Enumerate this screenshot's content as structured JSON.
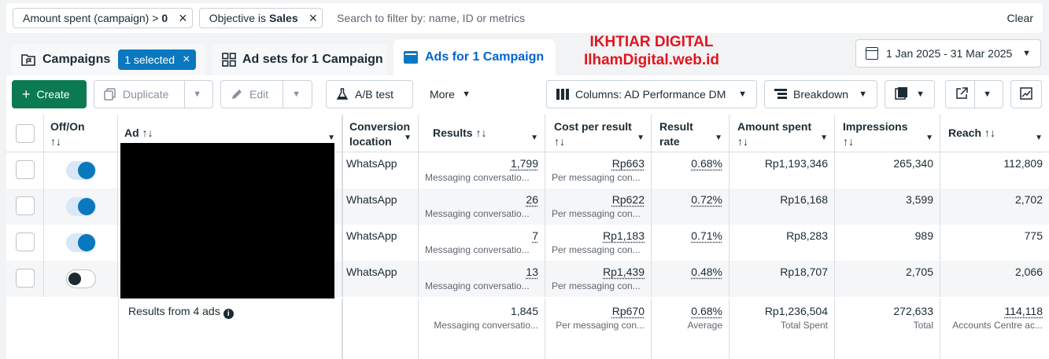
{
  "filters": [
    {
      "prefix": "Amount spent (campaign) >",
      "value": "0"
    },
    {
      "prefix": "Objective is",
      "value": "Sales"
    }
  ],
  "search": {
    "placeholder": "Search to filter by: name, ID or metrics"
  },
  "clear_label": "Clear",
  "tabs": {
    "campaigns": {
      "label": "Campaigns",
      "badge": "1 selected"
    },
    "adsets": {
      "label": "Ad sets for 1 Campaign"
    },
    "ads": {
      "label": "Ads for 1 Campaign"
    }
  },
  "watermark": {
    "line1": "IKHTIAR DIGITAL",
    "line2": "IlhamDigital.web.id"
  },
  "date_range": "1 Jan 2025 - 31 Mar 2025",
  "toolbar": {
    "create": "Create",
    "duplicate": "Duplicate",
    "edit": "Edit",
    "ab_test": "A/B test",
    "more": "More",
    "columns": "Columns: AD Performance DM",
    "breakdown": "Breakdown"
  },
  "columns": {
    "offon": "Off/On",
    "ad": "Ad",
    "conversion_location": "Conversion location",
    "results": "Results",
    "cost_per_result": "Cost per result",
    "result_rate": "Result rate",
    "amount_spent": "Amount spent",
    "impressions": "Impressions",
    "reach": "Reach",
    "sort_glyph": "↑↓"
  },
  "rows": [
    {
      "on": true,
      "location": "WhatsApp",
      "results": "1,799",
      "results_sub": "Messaging conversatio...",
      "cpr": "Rp663",
      "cpr_sub": "Per messaging con...",
      "rate": "0.68%",
      "spent": "Rp1,193,346",
      "impressions": "265,340",
      "reach": "112,809"
    },
    {
      "on": true,
      "location": "WhatsApp",
      "results": "26",
      "results_sub": "Messaging conversatio...",
      "cpr": "Rp622",
      "cpr_sub": "Per messaging con...",
      "rate": "0.72%",
      "spent": "Rp16,168",
      "impressions": "3,599",
      "reach": "2,702"
    },
    {
      "on": true,
      "location": "WhatsApp",
      "results": "7",
      "results_sub": "Messaging conversatio...",
      "cpr": "Rp1,183",
      "cpr_sub": "Per messaging con...",
      "rate": "0.71%",
      "spent": "Rp8,283",
      "impressions": "989",
      "reach": "775"
    },
    {
      "on": false,
      "location": "WhatsApp",
      "results": "13",
      "results_sub": "Messaging conversatio...",
      "cpr": "Rp1,439",
      "cpr_sub": "Per messaging con...",
      "rate": "0.48%",
      "spent": "Rp18,707",
      "impressions": "2,705",
      "reach": "2,066"
    }
  ],
  "totals": {
    "label": "Results from 4 ads",
    "results": "1,845",
    "results_sub": "Messaging conversatio...",
    "cpr": "Rp670",
    "cpr_sub": "Per messaging con...",
    "rate": "0.68%",
    "rate_sub": "Average",
    "spent": "Rp1,236,504",
    "spent_sub": "Total Spent",
    "impressions": "272,633",
    "impressions_sub": "Total",
    "reach": "114,118",
    "reach_sub": "Accounts Centre ac..."
  }
}
